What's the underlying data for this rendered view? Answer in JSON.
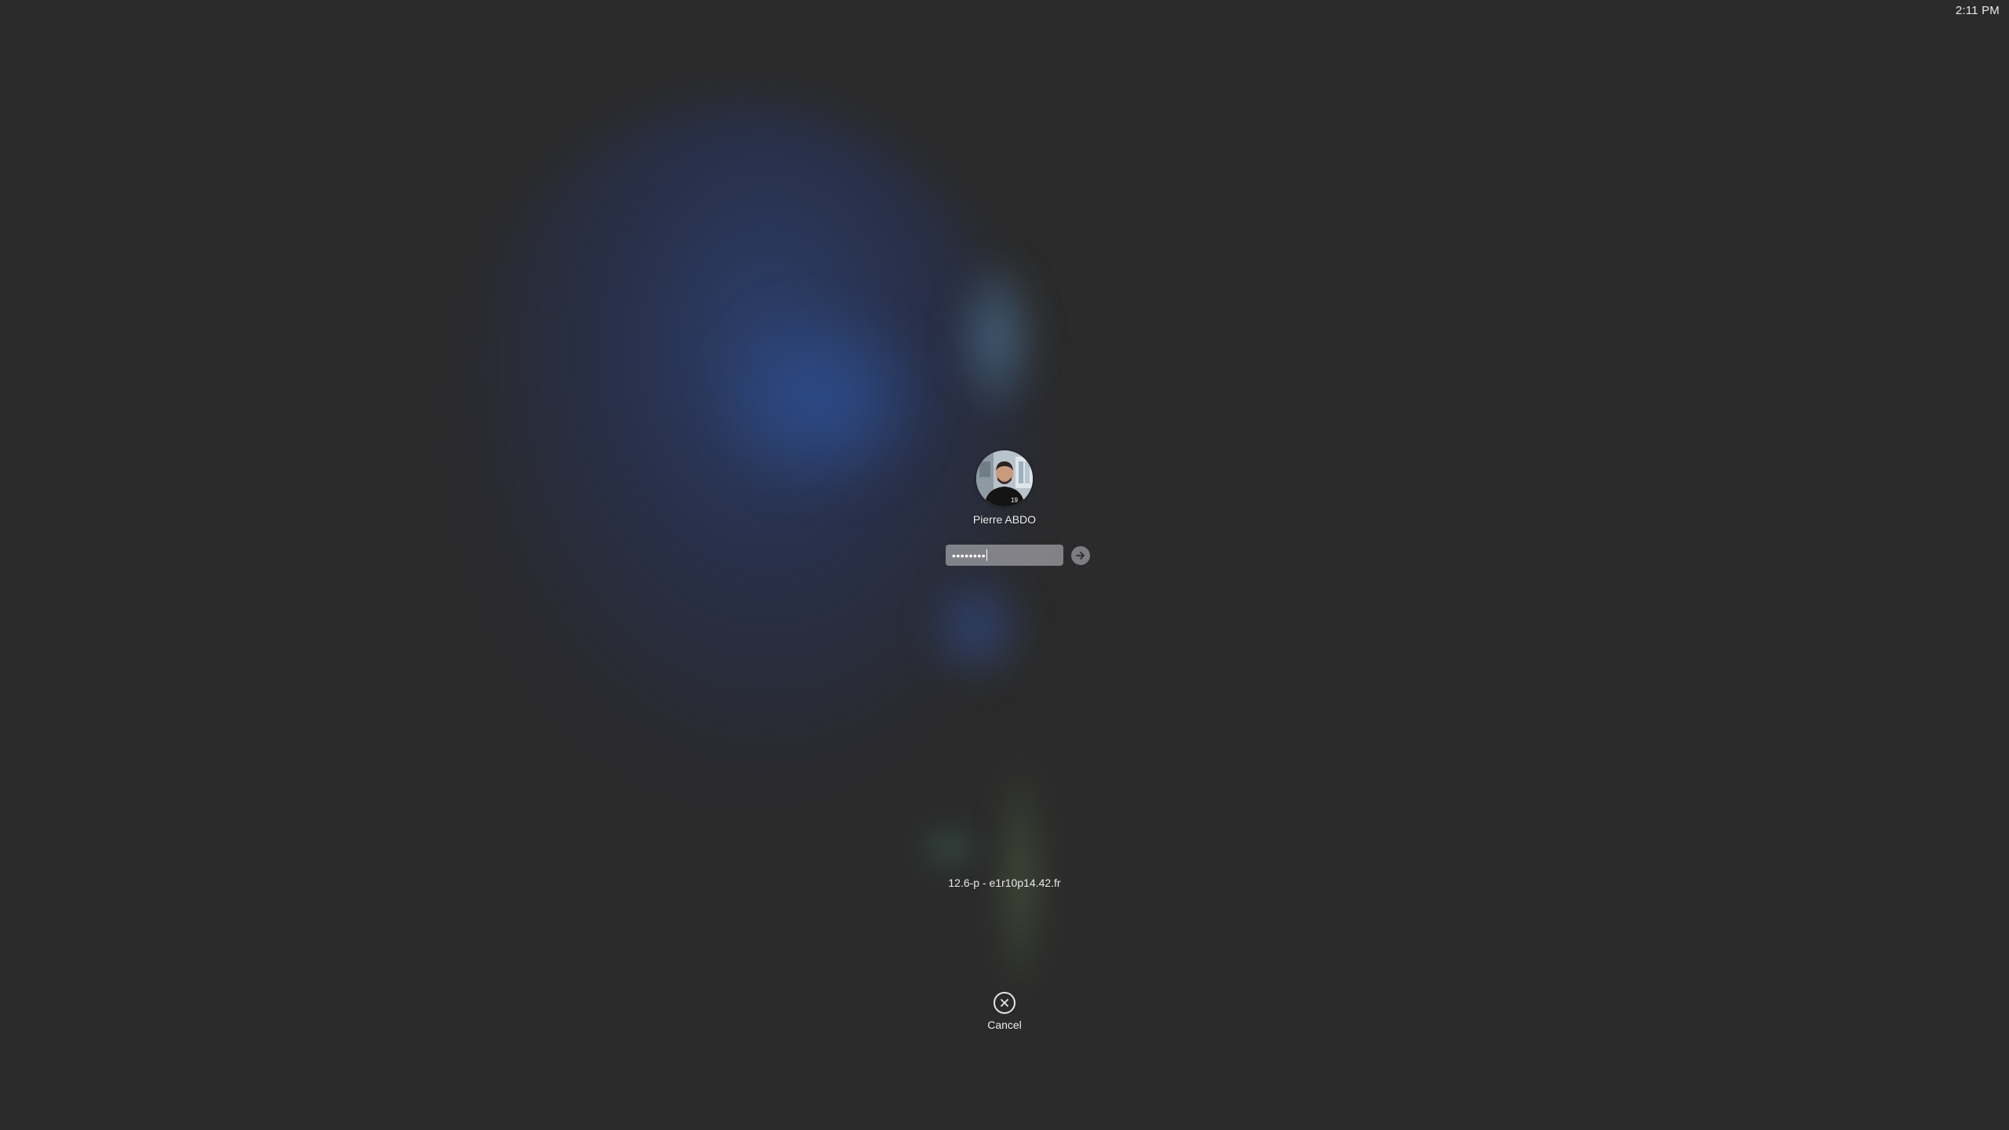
{
  "menubar": {
    "clock": "2:11 PM"
  },
  "login": {
    "avatar_icon": "user-avatar-photo",
    "username": "Pierre ABDO",
    "password_masked": "••••••••",
    "submit_icon": "arrow-right-icon"
  },
  "footer": {
    "host_info": "12.6-p - e1r10p14.42.fr",
    "cancel_icon": "close-circle-icon",
    "cancel_label": "Cancel"
  },
  "colors": {
    "background": "#2b2b2b",
    "glow_blue": "#2d4682",
    "text": "#ffffff"
  }
}
